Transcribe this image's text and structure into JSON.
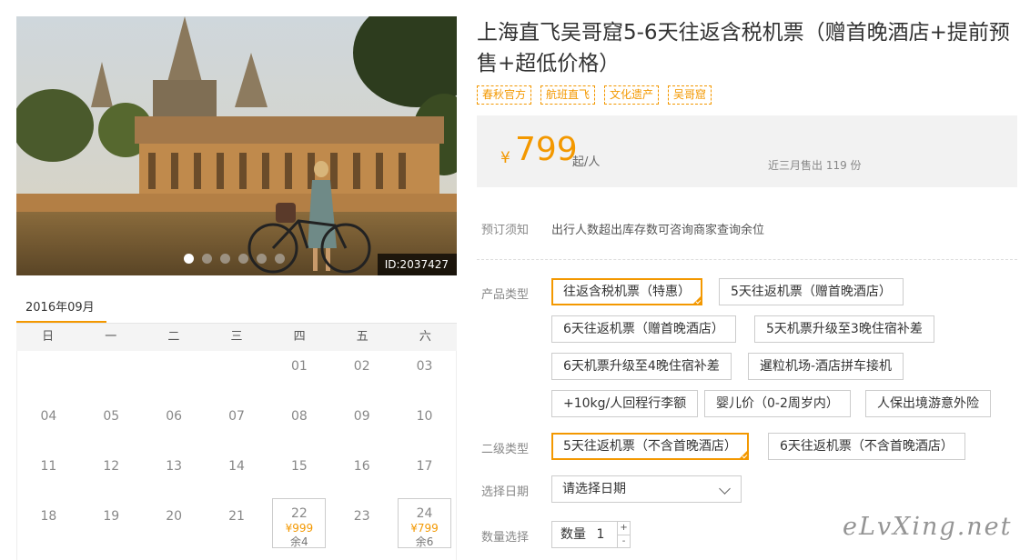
{
  "gallery": {
    "photo_id": "ID:2037427",
    "slide_count": 6,
    "active_slide": 0
  },
  "calendar": {
    "month_label": "2016年09月",
    "weekdays": [
      "日",
      "一",
      "二",
      "三",
      "四",
      "五",
      "六"
    ],
    "days": [
      {
        "d": ""
      },
      {
        "d": ""
      },
      {
        "d": ""
      },
      {
        "d": ""
      },
      {
        "d": "01"
      },
      {
        "d": "02"
      },
      {
        "d": "03"
      },
      {
        "d": "04"
      },
      {
        "d": "05"
      },
      {
        "d": "06"
      },
      {
        "d": "07"
      },
      {
        "d": "08"
      },
      {
        "d": "09"
      },
      {
        "d": "10"
      },
      {
        "d": "11"
      },
      {
        "d": "12"
      },
      {
        "d": "13"
      },
      {
        "d": "14"
      },
      {
        "d": "15"
      },
      {
        "d": "16"
      },
      {
        "d": "17"
      },
      {
        "d": "18"
      },
      {
        "d": "19"
      },
      {
        "d": "20"
      },
      {
        "d": "21"
      },
      {
        "d": "22",
        "price": "¥999",
        "stock": "余4"
      },
      {
        "d": "23"
      },
      {
        "d": "24",
        "price": "¥799",
        "stock": "余6"
      }
    ]
  },
  "product": {
    "title": "上海直飞吴哥窟5-6天往返含税机票（赠首晚酒店+提前预售+超低价格）",
    "tags": [
      "春秋官方",
      "航班直飞",
      "文化遗产",
      "吴哥窟"
    ]
  },
  "price": {
    "currency": "¥",
    "amount": "799",
    "unit": "起/人",
    "sold": "近三月售出 119 份"
  },
  "booking": {
    "notice_label": "预订须知",
    "notice_text": "出行人数超出库存数可咨询商家查询余位",
    "type_label": "产品类型",
    "types": [
      "往返含税机票（特惠）",
      "5天往返机票（赠首晚酒店）",
      "6天往返机票（赠首晚酒店）",
      "5天机票升级至3晚住宿补差",
      "6天机票升级至4晚住宿补差",
      "暹粒机场-酒店拼车接机",
      "+10kg/人回程行李额",
      "婴儿价（0-2周岁内）",
      "人保出境游意外险"
    ],
    "subtype_label": "二级类型",
    "subtypes": [
      "5天往返机票（不含首晚酒店）",
      "6天往返机票（不含首晚酒店）"
    ],
    "date_label": "选择日期",
    "date_placeholder": "请选择日期",
    "qty_label": "数量选择",
    "qty_inner_label": "数量",
    "qty_value": "1",
    "qty_plus": "+",
    "qty_minus": "-"
  },
  "watermark": "eLvXing.net",
  "colors": {
    "accent": "#f39800",
    "panel": "#f2f2f2"
  }
}
